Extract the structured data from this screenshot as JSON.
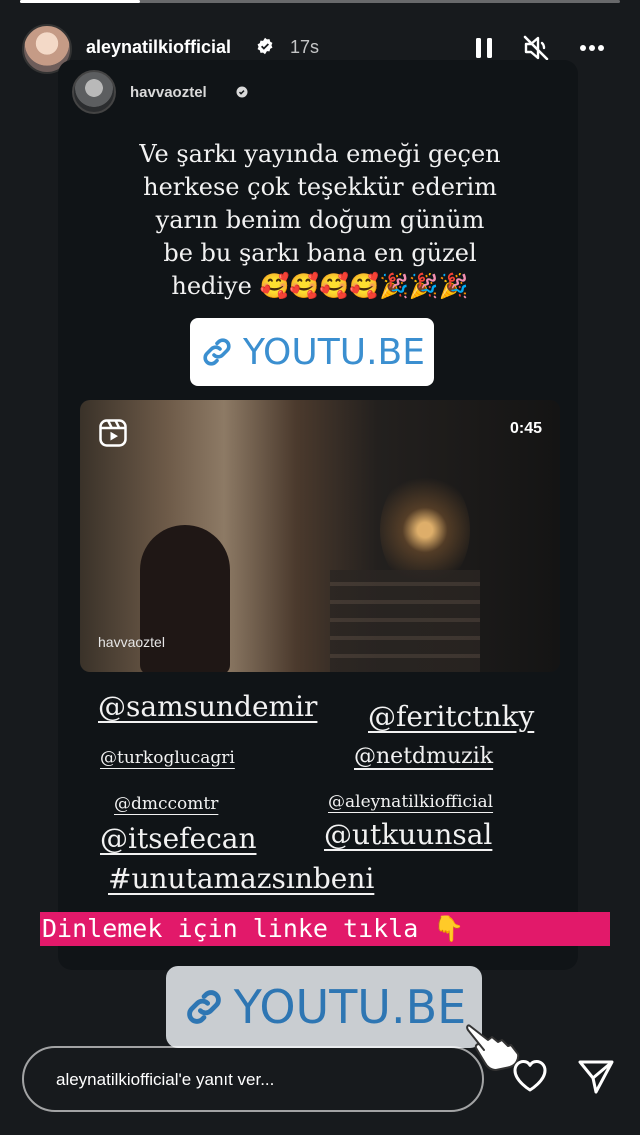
{
  "story": {
    "progress": 0.2,
    "username": "aleynatilkiofficial",
    "time": "17s"
  },
  "shared_post": {
    "username": "havvaoztel",
    "caption_lines": [
      "Ve şarkı yayında emeği geçen",
      "herkese çok teşekkür ederim",
      "yarın benim doğum günüm",
      "be bu şarkı bana en güzel",
      "hediye 🥰🥰🥰🥰🎉🎉🎉"
    ],
    "link_label": "YOUTU.BE",
    "reel": {
      "duration": "0:45",
      "username": "havvaoztel"
    }
  },
  "mentions": [
    "@samsundemir",
    "@feritctnky",
    "@turkoglucagri",
    "@netdmuzik",
    "@dmccomtr",
    "@aleynatilkiofficial",
    "@itsefecan",
    "@utkuunsal",
    "#unutamazsınbeni"
  ],
  "cta": "Dinlemek için linke tıkla 👇",
  "bottom_link": "YOUTU.BE",
  "reply_placeholder": "aleynatilkiofficial'e yanıt ver...",
  "icons": {
    "pause": "pause-icon",
    "mute": "speaker-muted-icon",
    "more": "more-icon",
    "heart": "heart-icon",
    "send": "send-icon"
  }
}
